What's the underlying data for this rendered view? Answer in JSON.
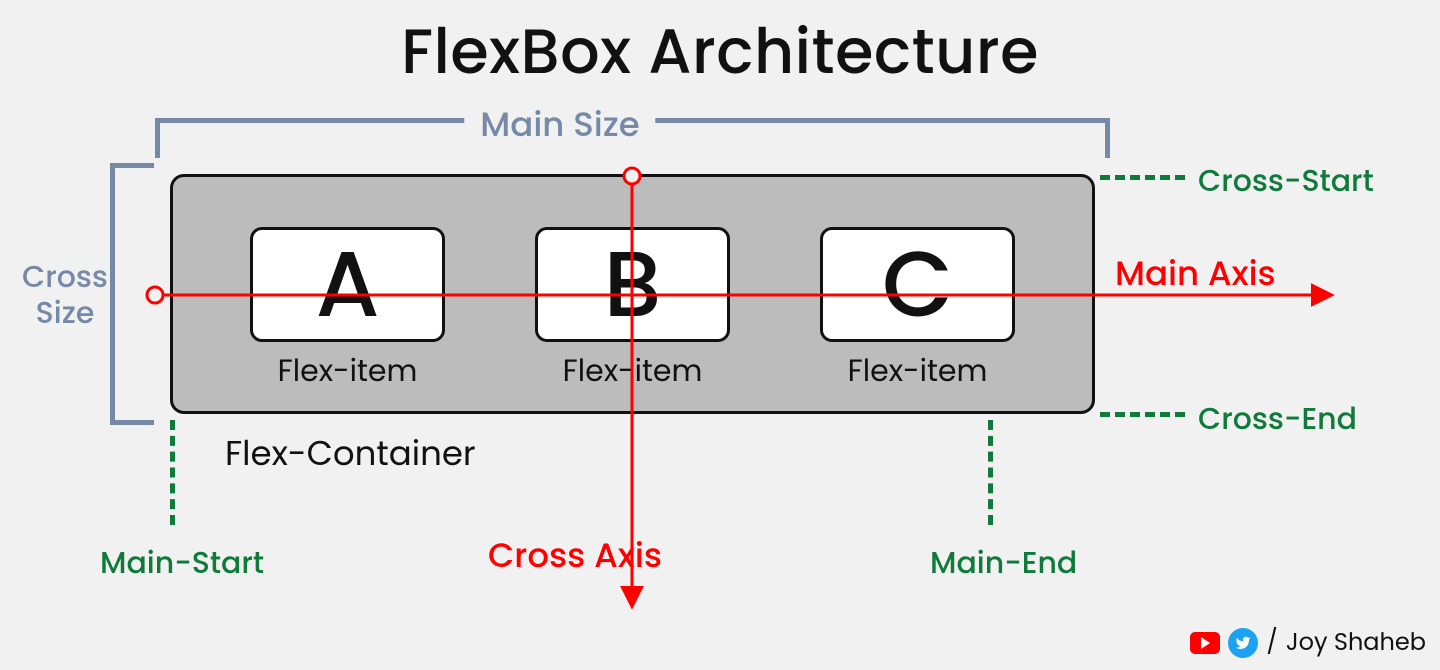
{
  "title": "FlexBox Architecture",
  "container_label": "Flex-Container",
  "items": [
    {
      "letter": "A",
      "label": "Flex-item"
    },
    {
      "letter": "B",
      "label": "Flex-item"
    },
    {
      "letter": "C",
      "label": "Flex-item"
    }
  ],
  "labels": {
    "main_size": "Main Size",
    "cross_size": "Cross\nSize",
    "main_axis": "Main Axis",
    "cross_axis": "Cross Axis",
    "cross_start": "Cross-Start",
    "cross_end": "Cross-End",
    "main_start": "Main-Start",
    "main_end": "Main-End"
  },
  "credit": {
    "prefix": "/",
    "name": "Joy Shaheb"
  },
  "colors": {
    "bracket": "#7689a6",
    "axis": "#ff0000",
    "green": "#0f7b3a"
  }
}
